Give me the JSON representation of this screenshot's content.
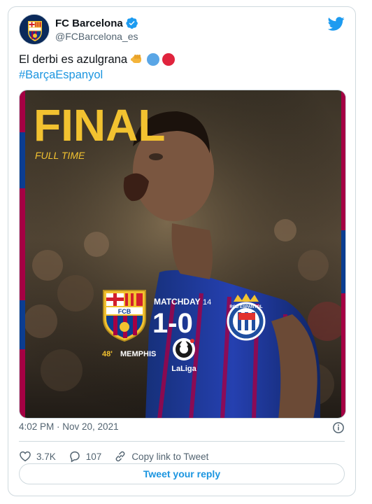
{
  "account": {
    "name": "FC Barcelona",
    "handle": "@FCBarcelona_es",
    "avatar_label": "FCB"
  },
  "tweet": {
    "text": "El derbi es azulgrana",
    "hashtag": "#BarçaEspanyol",
    "emoji_colors": [
      "#5aa6e6",
      "#e0243d"
    ]
  },
  "media": {
    "headline": "FINAL",
    "subhead": "FULL TIME",
    "matchday_label": "MATCHDAY",
    "matchday_number": "14",
    "score": "1-0",
    "home_crest": "FCB",
    "away_crest": "RCD ESPANYOL",
    "scorer_minute": "48'",
    "scorer_name": "MEMPHIS",
    "league": "LaLiga"
  },
  "meta": {
    "timestamp": "4:02 PM · Nov 20, 2021"
  },
  "actions": {
    "likes": "3.7K",
    "replies": "107",
    "copy_link": "Copy link to Tweet"
  },
  "reply_button": "Tweet your reply",
  "colors": {
    "twitter_blue": "#1b95e0",
    "barca_blue": "#0b3d91",
    "barca_red": "#a50044",
    "gold": "#f2c230"
  }
}
